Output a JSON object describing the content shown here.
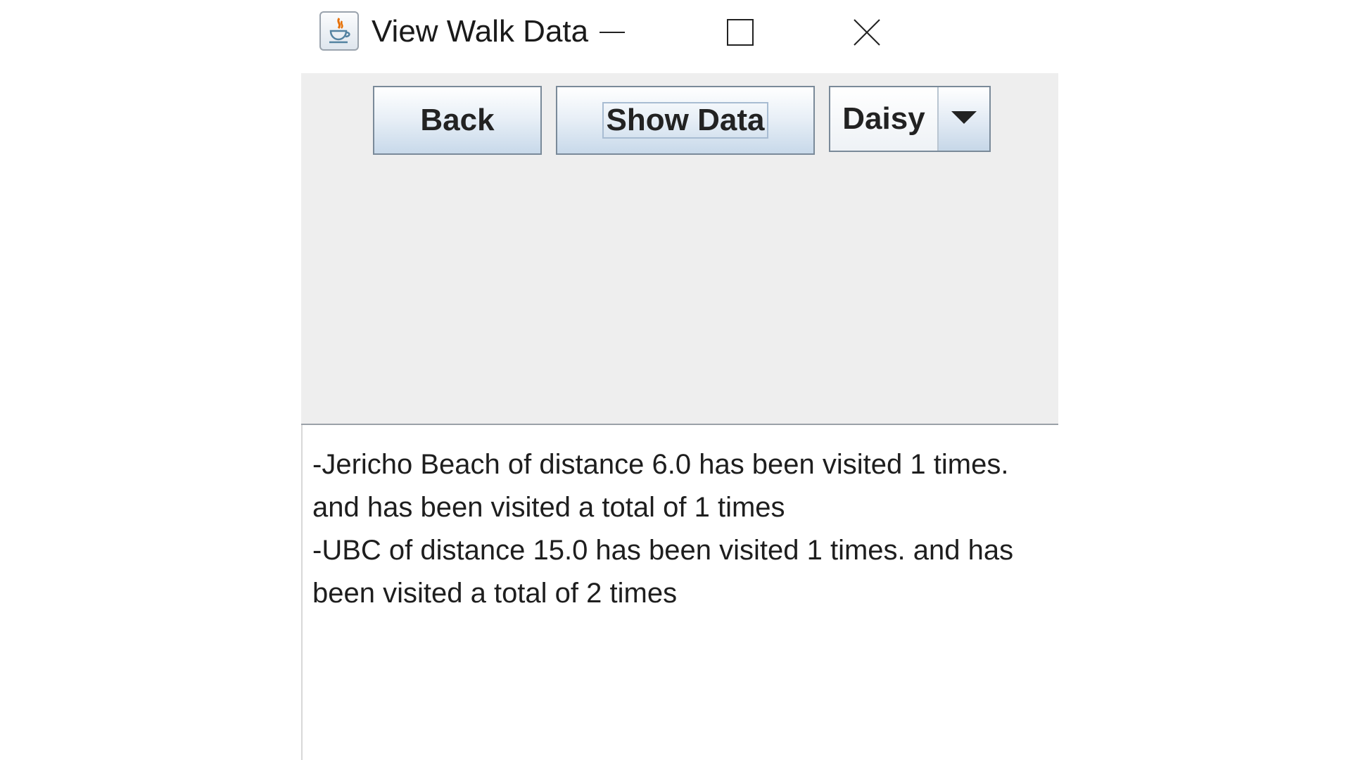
{
  "window": {
    "title": "View Walk Data",
    "icon": "java-icon",
    "controls": [
      "minimize-icon",
      "maximize-icon",
      "close-icon"
    ]
  },
  "toolbar": {
    "back_label": "Back",
    "show_data_label": "Show Data",
    "walker_select": {
      "selected": "Daisy",
      "icon": "chevron-down-icon"
    }
  },
  "output": {
    "text": "-Jericho Beach of distance 6.0 has been visited 1 times. and has been visited a total of 1 times\n-UBC of distance 15.0 has been visited 1 times. and has been visited a total of 2 times"
  },
  "colors": {
    "panel_background": "#eeeeee",
    "button_gradient_top": "#ffffff",
    "button_gradient_bottom": "#c8d9ea",
    "button_border": "#7a8a99"
  }
}
